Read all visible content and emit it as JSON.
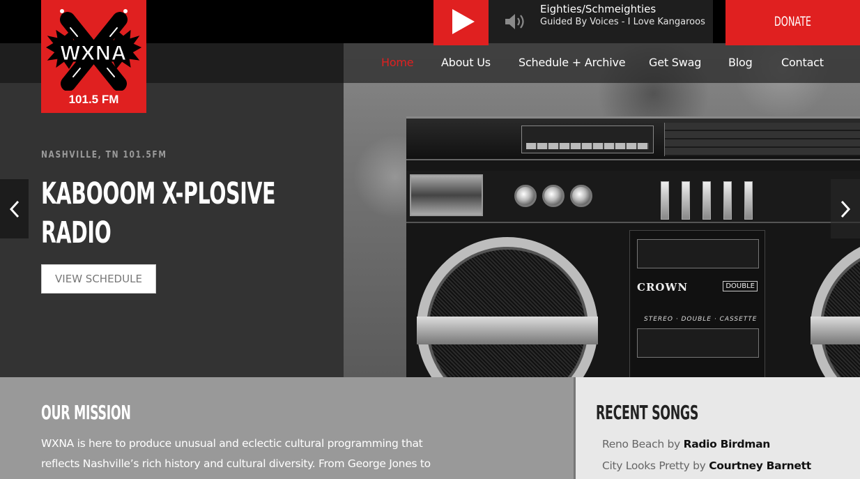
{
  "logo": {
    "wordmark": "WXNA",
    "frequency": "101.5 FM"
  },
  "player": {
    "play_icon": "play-icon",
    "volume_icon": "speaker-volume-icon",
    "show": "Eighties/Schmeighties",
    "track": "Guided By Voices - I Love Kangaroos"
  },
  "donate_label": "DONATE",
  "nav": {
    "items": [
      {
        "label": "Home",
        "active": true
      },
      {
        "label": "About Us",
        "active": false
      },
      {
        "label": "Schedule + Archive",
        "active": false
      },
      {
        "label": "Get Swag",
        "active": false
      },
      {
        "label": "Blog",
        "active": false
      },
      {
        "label": "Contact",
        "active": false
      }
    ]
  },
  "hero": {
    "eyebrow": "NASHVILLE, TN 101.5FM",
    "title_line1": "KABOOOM X-PLOSIVE",
    "title_line2": "RADIO",
    "button_label": "VIEW SCHEDULE",
    "prev_icon": "chevron-left-icon",
    "next_icon": "chevron-right-icon",
    "image": {
      "brand": "CROWN",
      "badge": "DOUBLE",
      "caption": "STEREO · DOUBLE · CASSETTE"
    }
  },
  "mission": {
    "title": "OUR MISSION",
    "text": "WXNA is here to produce unusual and eclectic cultural programming that reflects Nashville’s rich history and cultural diversity. From George Jones to"
  },
  "recent_songs": {
    "title": "RECENT SONGS",
    "by_label": "by",
    "items": [
      {
        "title": "Reno Beach",
        "artist": "Radio Birdman"
      },
      {
        "title": "City Looks Pretty",
        "artist": "Courtney Barnett"
      }
    ]
  },
  "colors": {
    "accent": "#e02020",
    "dark": "#333333",
    "mission_bg": "#999999",
    "recent_bg": "#e8e8e8"
  }
}
